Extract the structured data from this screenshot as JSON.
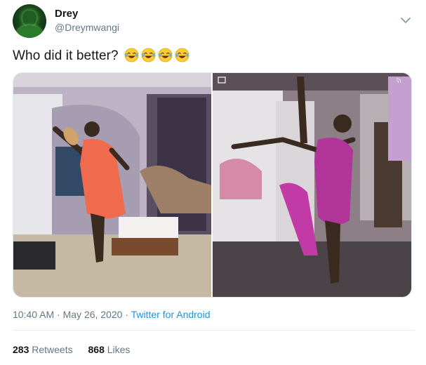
{
  "tweet": {
    "author_name": "Drey",
    "author_handle": "@Dreymwangi",
    "text": "Who did it better?",
    "emojis": [
      "face-with-tears-of-joy",
      "face-with-tears-of-joy",
      "face-with-tears-of-joy",
      "face-with-tears-of-joy"
    ],
    "time": "10:40 AM",
    "separator": "·",
    "date": "May 26, 2020",
    "source": "Twitter for Android",
    "retweets_count": "283",
    "retweets_label": "Retweets",
    "likes_count": "868",
    "likes_label": "Likes"
  },
  "media": [
    {
      "icon": "photo-man-kicking-pose"
    },
    {
      "icon": "photo-woman-kicking-pose"
    }
  ],
  "colors": {
    "link": "#1b95e0",
    "secondary_text": "#657786",
    "primary_text": "#14171a",
    "divider": "#e6ecf0"
  }
}
